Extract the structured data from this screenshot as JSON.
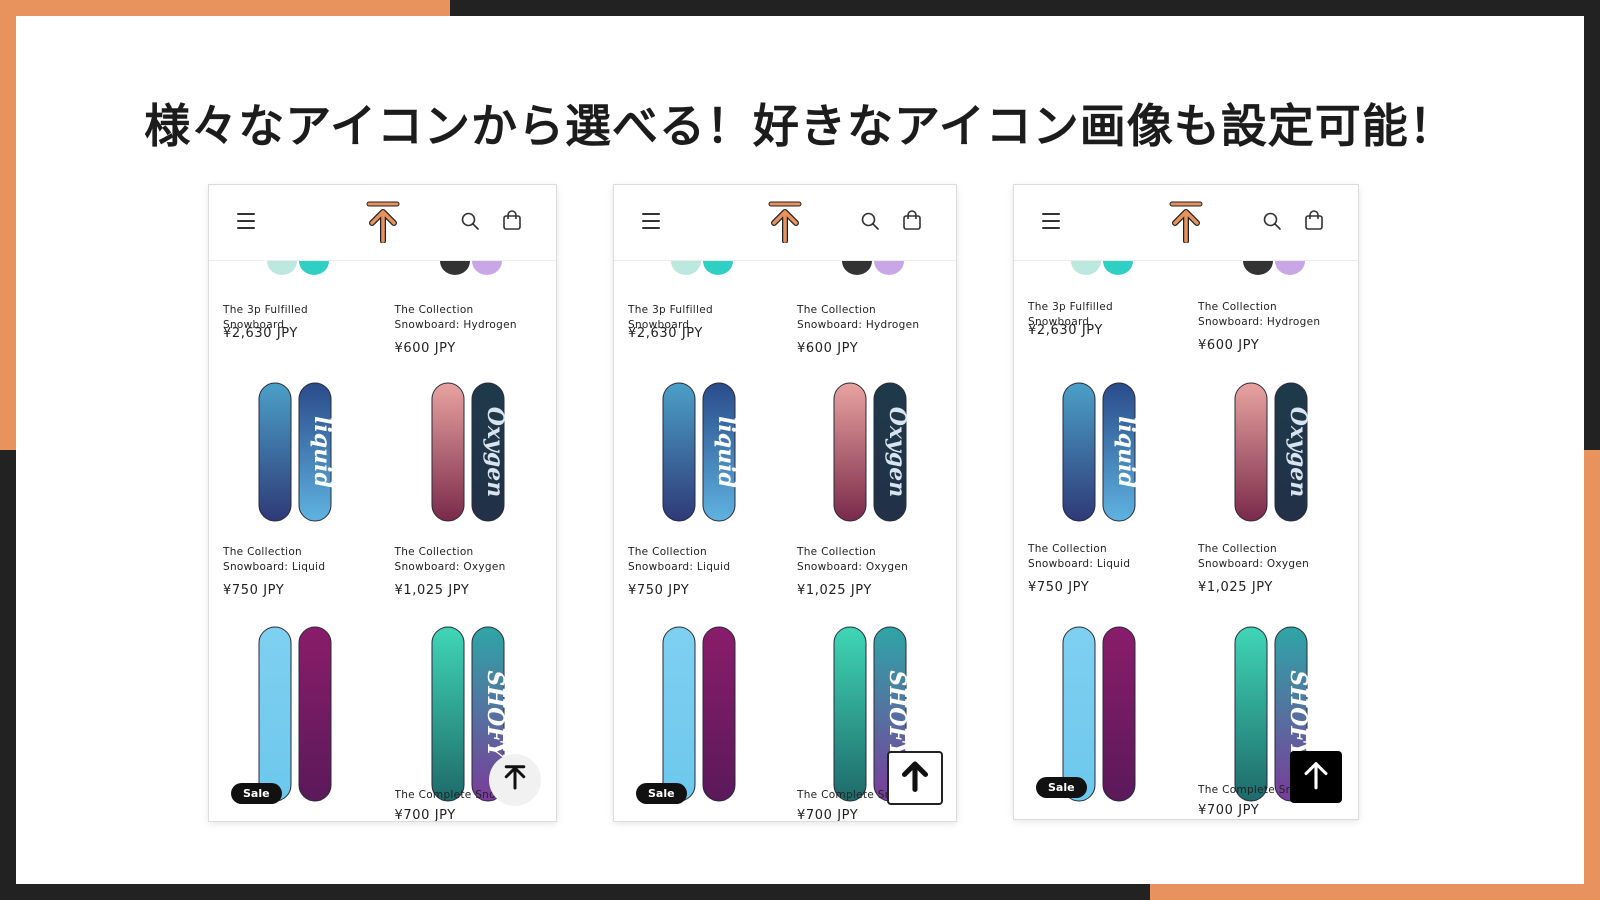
{
  "headline": "様々なアイコンから選べる！好きなアイコン画像も設定可能！",
  "colors": {
    "accent": "#e8935e",
    "dark": "#222222"
  },
  "icons": {
    "menu": "hamburger-menu-icon",
    "logo": "arrow-to-top-logo-icon",
    "search": "search-icon",
    "cart": "cart-icon",
    "back_to_top": "arrow-up-icon"
  },
  "products": [
    {
      "title": "The 3p Fulfilled Snowboard",
      "price": "¥2,630 JPY"
    },
    {
      "title": "The Collection Snowboard: Hydrogen",
      "price": "¥600 JPY"
    },
    {
      "title": "The Collection Snowboard: Liquid",
      "price": "¥750 JPY"
    },
    {
      "title": "The Collection Snowboard: Oxygen",
      "price": "¥1,025 JPY"
    },
    {
      "title": "",
      "price": "",
      "badge": "Sale"
    },
    {
      "title": "The Complete Snowboard",
      "price": "¥700 JPY"
    }
  ],
  "variants": [
    {
      "back_to_top_style": "round-light"
    },
    {
      "back_to_top_style": "square-outlined"
    },
    {
      "back_to_top_style": "square-black"
    }
  ]
}
